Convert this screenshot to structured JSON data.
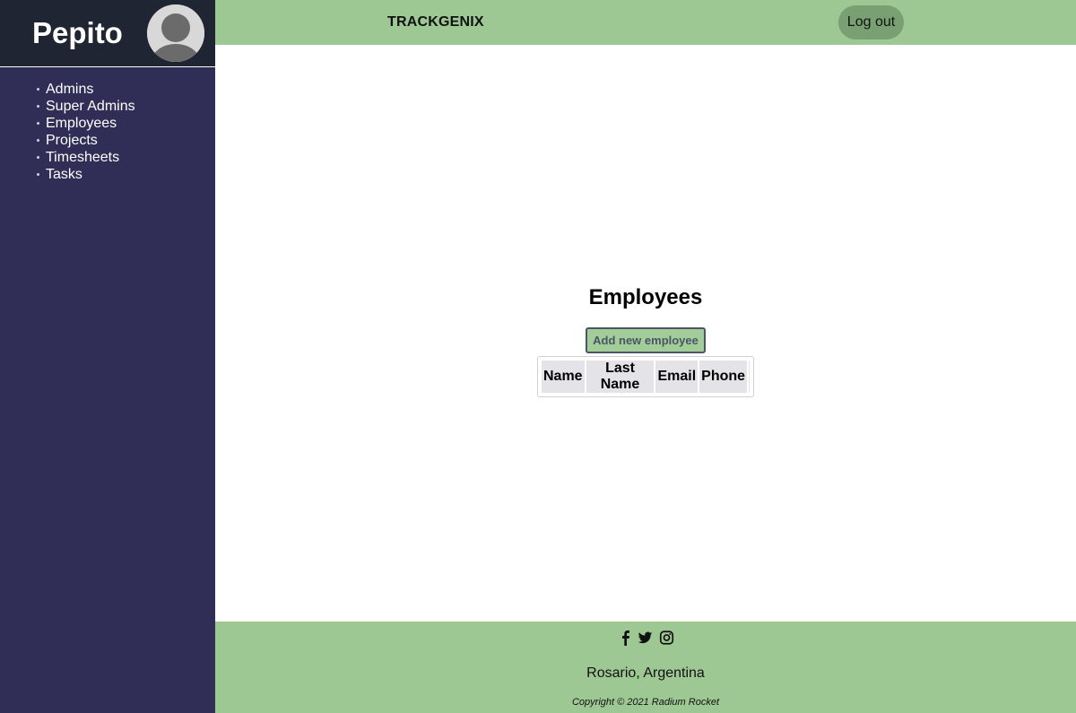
{
  "sidebar": {
    "user_name": "Pepito",
    "avatar_icon": "user-avatar-icon",
    "items": [
      {
        "label": "Admins"
      },
      {
        "label": "Super Admins"
      },
      {
        "label": "Employees"
      },
      {
        "label": "Projects"
      },
      {
        "label": "Timesheets"
      },
      {
        "label": "Tasks"
      }
    ]
  },
  "header": {
    "title": "TRACKGENIX",
    "logout_label": "Log out"
  },
  "main": {
    "title": "Employees",
    "add_button_label": "Add new employee",
    "table": {
      "columns": [
        "Name",
        "Last Name",
        "Email",
        "Phone"
      ],
      "rows": []
    }
  },
  "footer": {
    "social_icons": [
      "facebook-icon",
      "twitter-icon",
      "instagram-icon"
    ],
    "location": "Rosario, Argentina",
    "copyright": "Copyright © 2021 Radium Rocket"
  },
  "colors": {
    "sidebar_bg": "#302e56",
    "sidebar_header_bg": "#1f2533",
    "accent_green": "#9dc893",
    "logout_bg": "#79a072"
  }
}
